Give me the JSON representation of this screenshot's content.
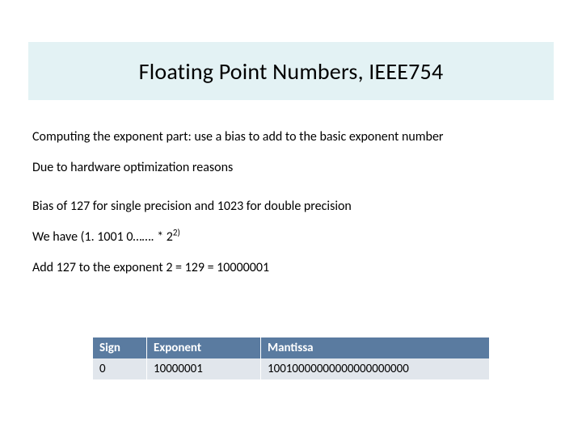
{
  "title": "Floating Point Numbers, IEEE754",
  "lines": {
    "l1": "Computing the exponent part: use a bias to add to the basic exponent number",
    "l2": "Due to hardware optimization reasons",
    "l3": "Bias of 127 for single precision and 1023 for double precision",
    "l4_pre": "We have  (1. 1001 0……. * 2",
    "l4_sup": "2)",
    "l5": "Add 127 to the exponent 2 = 129 = 10000001"
  },
  "table": {
    "headers": {
      "sign": "Sign",
      "exponent": "Exponent",
      "mantissa": "Mantissa"
    },
    "row": {
      "sign": "0",
      "exponent": "10000001",
      "mantissa": "10010000000000000000000"
    }
  }
}
